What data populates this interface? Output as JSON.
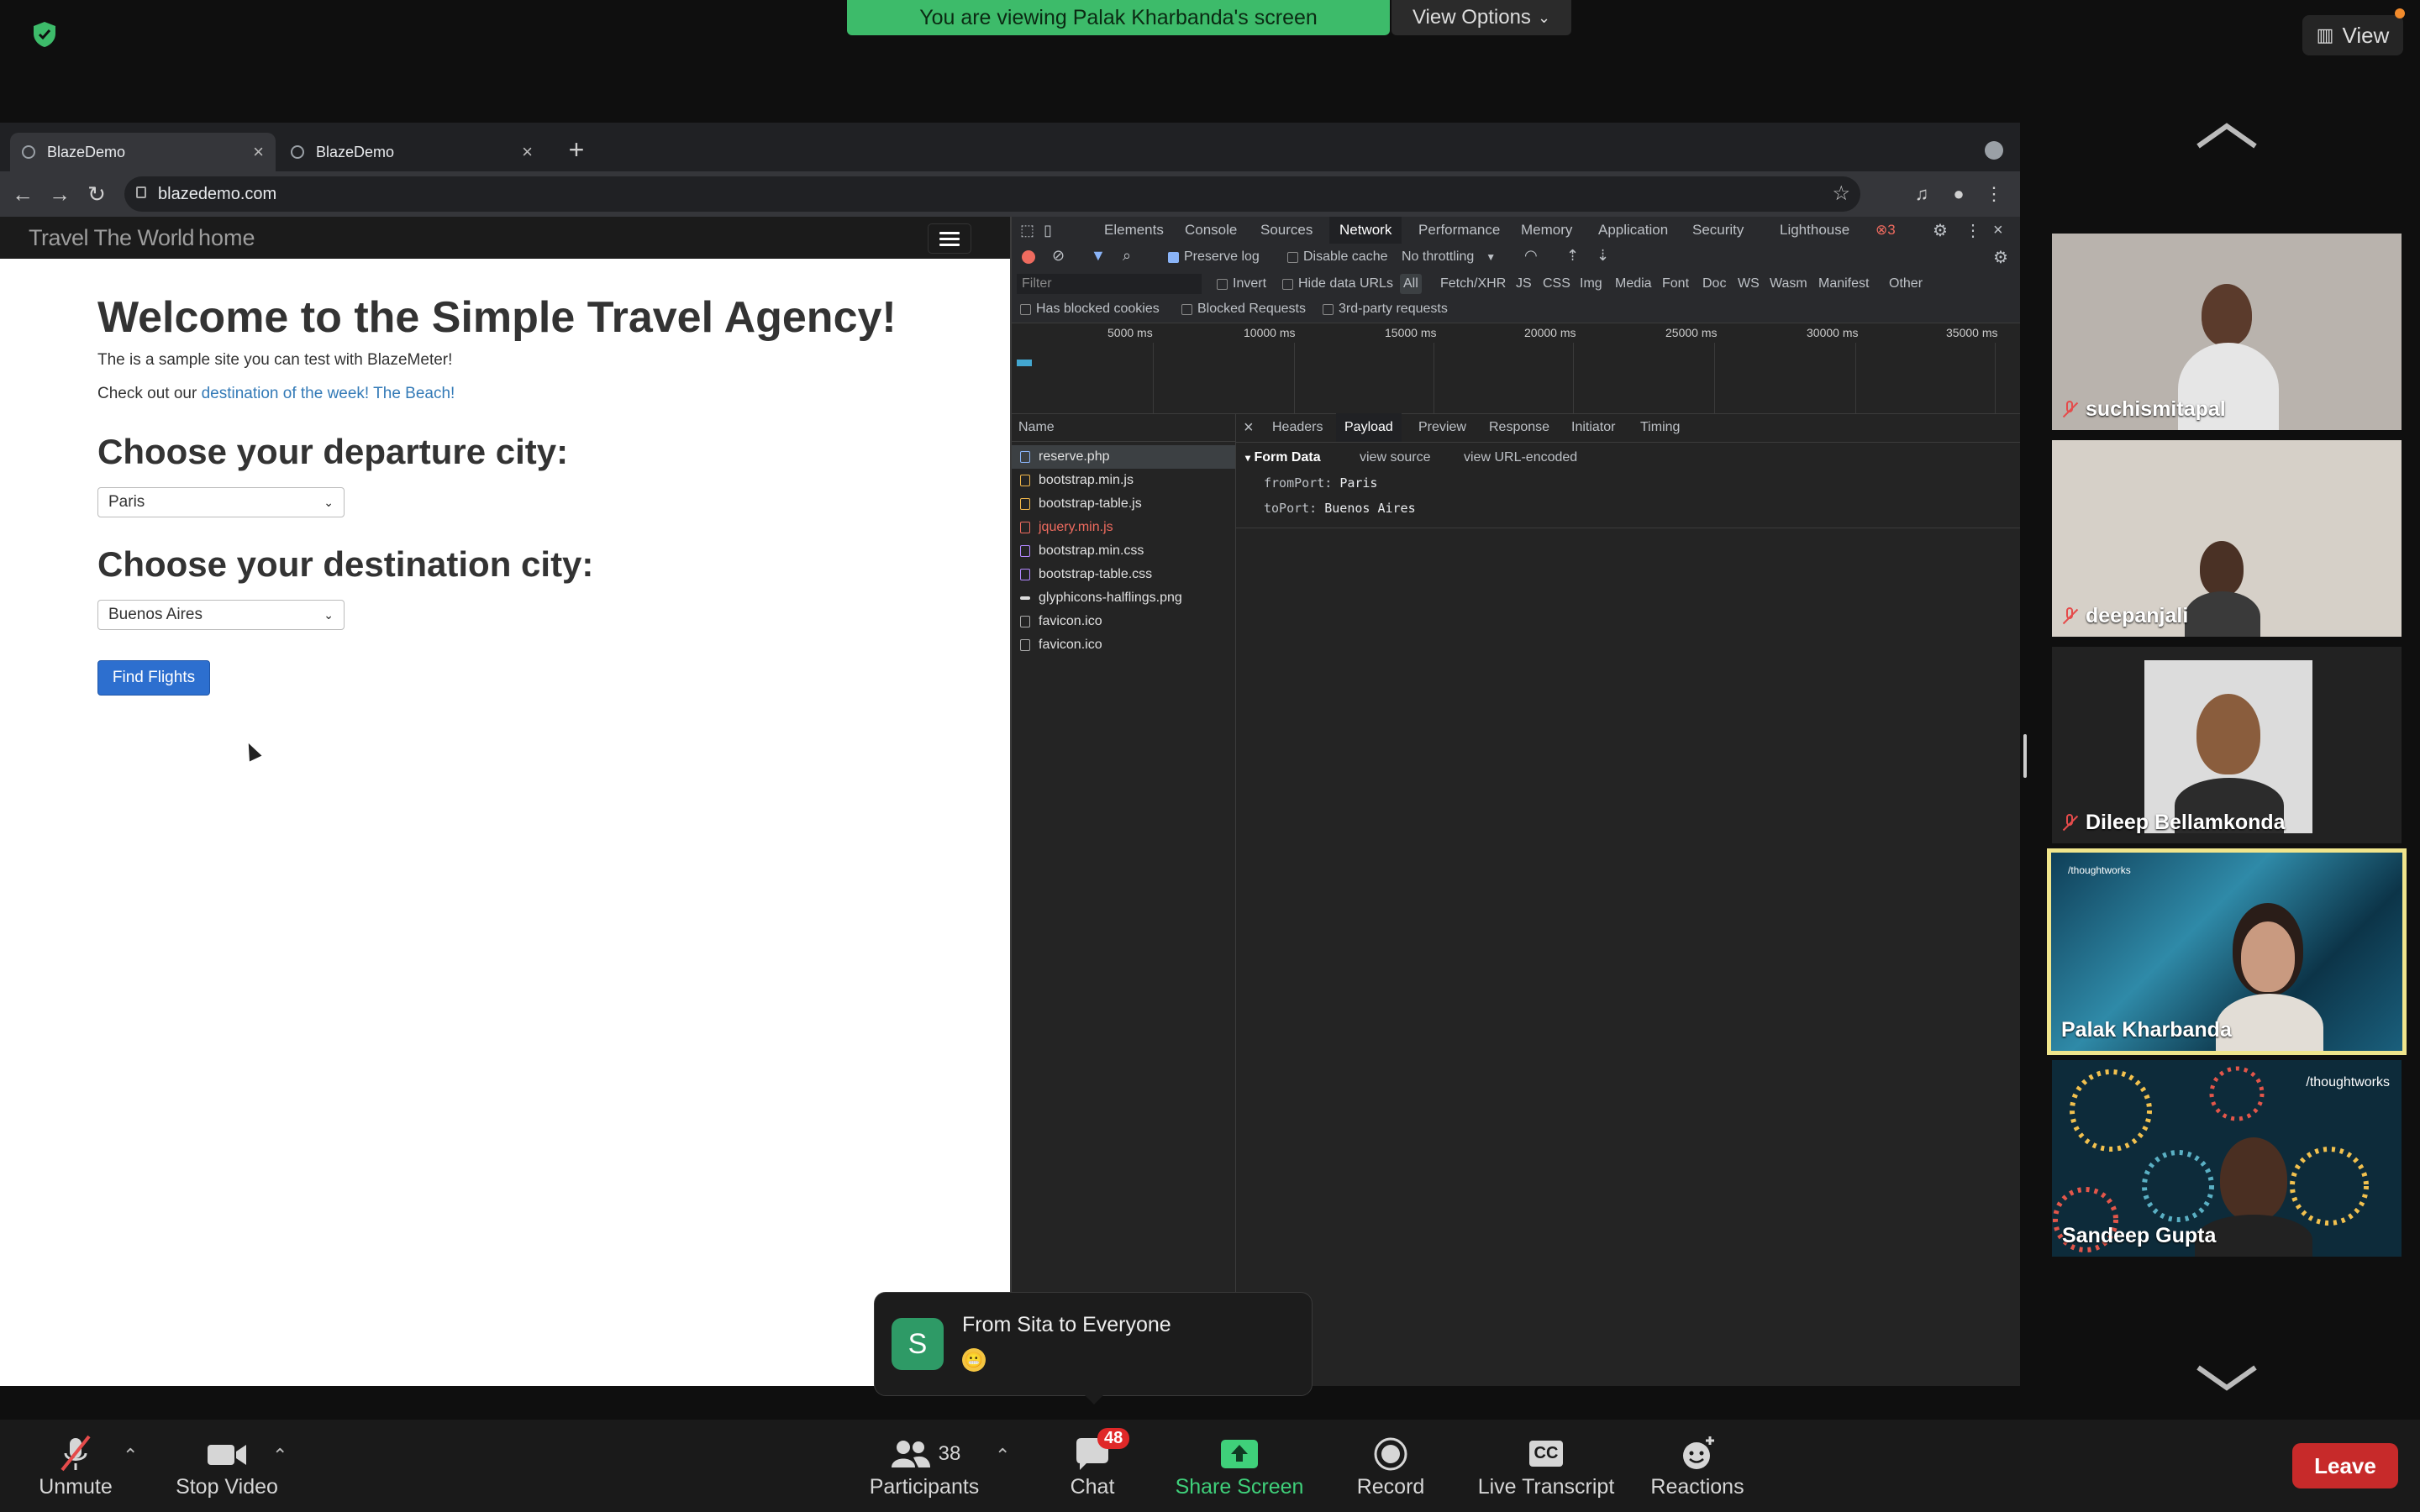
{
  "zoom": {
    "banner_text": "You are viewing Palak Kharbanda's screen",
    "view_options_label": "View Options",
    "view_label": "View"
  },
  "browser": {
    "tabs": [
      {
        "title": "BlazeDemo"
      },
      {
        "title": "BlazeDemo"
      }
    ],
    "url": "blazedemo.com"
  },
  "site": {
    "brand": "Travel The World",
    "nav_home": "home",
    "heading": "Welcome to the Simple Travel Agency!",
    "intro": "The is a sample site you can test with BlazeMeter!",
    "checkout_prefix": "Check out our",
    "checkout_link": "destination of the week! The Beach!",
    "departure_heading": "Choose your departure city:",
    "departure_value": "Paris",
    "destination_heading": "Choose your destination city:",
    "destination_value": "Buenos Aires",
    "find_button": "Find Flights"
  },
  "devtools": {
    "tabs": [
      "Elements",
      "Console",
      "Sources",
      "Network",
      "Performance",
      "Memory",
      "Application",
      "Security",
      "Lighthouse"
    ],
    "active_tab": "Network",
    "error_count": "3",
    "preserve_log": "Preserve log",
    "disable_cache": "Disable cache",
    "throttling": "No throttling",
    "filter_placeholder": "Filter",
    "invert": "Invert",
    "hide_data_urls": "Hide data URLs",
    "types": [
      "All",
      "Fetch/XHR",
      "JS",
      "CSS",
      "Img",
      "Media",
      "Font",
      "Doc",
      "WS",
      "Wasm",
      "Manifest",
      "Other"
    ],
    "has_blocked_cookies": "Has blocked cookies",
    "blocked_requests": "Blocked Requests",
    "third_party": "3rd-party requests",
    "timeline_ticks": [
      "5000 ms",
      "10000 ms",
      "15000 ms",
      "20000 ms",
      "25000 ms",
      "30000 ms",
      "35000 ms"
    ],
    "name_header": "Name",
    "requests": [
      {
        "name": "reserve.php",
        "kind": "doc"
      },
      {
        "name": "bootstrap.min.js",
        "kind": "js"
      },
      {
        "name": "bootstrap-table.js",
        "kind": "js"
      },
      {
        "name": "jquery.min.js",
        "kind": "err"
      },
      {
        "name": "bootstrap.min.css",
        "kind": "css"
      },
      {
        "name": "bootstrap-table.css",
        "kind": "css"
      },
      {
        "name": "glyphicons-halflings.png",
        "kind": "img"
      },
      {
        "name": "favicon.ico",
        "kind": "plain"
      },
      {
        "name": "favicon.ico",
        "kind": "plain"
      }
    ],
    "detail_tabs": [
      "Headers",
      "Payload",
      "Preview",
      "Response",
      "Initiator",
      "Timing"
    ],
    "active_detail_tab": "Payload",
    "form_data_title": "Form Data",
    "view_source": "view source",
    "view_url_encoded": "view URL-encoded",
    "form_data": [
      {
        "key": "fromPort:",
        "value": "Paris"
      },
      {
        "key": "toPort:",
        "value": "Buenos Aires"
      }
    ]
  },
  "participants": [
    {
      "name": "suchismitapal",
      "muted": true
    },
    {
      "name": "deepanjali",
      "muted": true
    },
    {
      "name": "Dileep Bellamkonda",
      "muted": true
    },
    {
      "name": "Palak Kharbanda",
      "muted": false,
      "active": true
    },
    {
      "name": "Sandeep Gupta",
      "muted": false
    }
  ],
  "tile_labels": {
    "thoughtworks": "/thoughtworks"
  },
  "chat_toast": {
    "avatar": "S",
    "title": "From Sita to Everyone",
    "emoji": "😬"
  },
  "bottom_bar": {
    "unmute": "Unmute",
    "stop_video": "Stop Video",
    "participants": "Participants",
    "participants_count": "38",
    "chat": "Chat",
    "chat_badge": "48",
    "share_screen": "Share Screen",
    "record": "Record",
    "live_transcript": "Live Transcript",
    "cc": "CC",
    "reactions": "Reactions",
    "leave": "Leave"
  },
  "colors": {
    "banner": "#3dbb6a",
    "leave": "#c72a2a",
    "share": "#3fd07a",
    "active_speaker": "#f0e58c"
  }
}
